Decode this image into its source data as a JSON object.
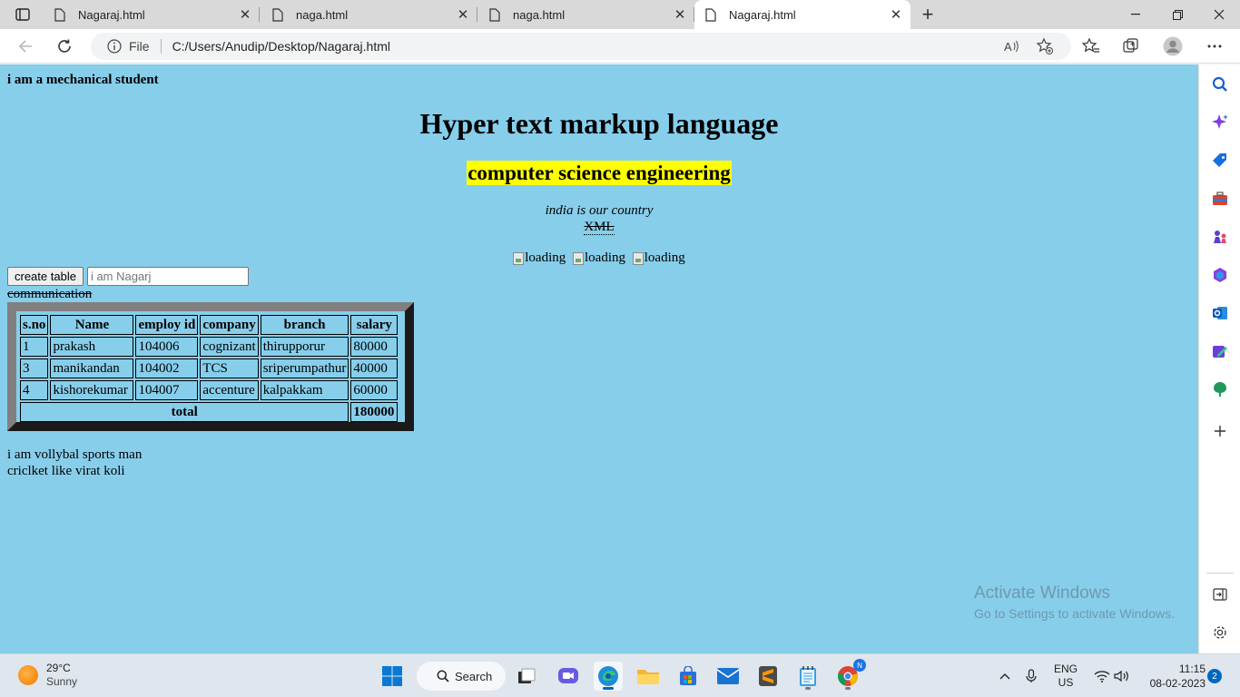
{
  "browser": {
    "tabs": [
      {
        "title": "Nagaraj.html",
        "active": false
      },
      {
        "title": "naga.html",
        "active": false
      },
      {
        "title": "naga.html",
        "active": false
      },
      {
        "title": "Nagaraj.html",
        "active": true
      }
    ],
    "address": {
      "scheme_label": "File",
      "url": "C:/Users/Anudip/Desktop/Nagaraj.html"
    }
  },
  "page": {
    "intro": "i am a mechanical student",
    "heading1": "Hyper text markup language",
    "heading2": "computer science engineering",
    "country": "india is our country",
    "xml": "XML",
    "images": [
      "loading",
      "loading",
      "loading"
    ],
    "button_label": "create table",
    "input_placeholder": "i am Nagarj",
    "strike_text": "communication",
    "table": {
      "headers": [
        "s.no",
        "Name",
        "employ id",
        "company",
        "branch",
        "salary"
      ],
      "rows": [
        [
          "1",
          "prakash",
          "104006",
          "cognizant",
          "thirupporur",
          "80000"
        ],
        [
          "3",
          "manikandan",
          "104002",
          "TCS",
          "sriperumpathur",
          "40000"
        ],
        [
          "4",
          "kishorekumar",
          "104007",
          "accenture",
          "kalpakkam",
          "60000"
        ]
      ],
      "total_label": "total",
      "total_value": "180000"
    },
    "line1": "i am vollybal sports man",
    "line2": "criclket like virat koli",
    "watermark_title": "Activate Windows",
    "watermark_sub": "Go to Settings to activate Windows."
  },
  "taskbar": {
    "weather_temp": "29°C",
    "weather_cond": "Sunny",
    "search_label": "Search",
    "lang_top": "ENG",
    "lang_bottom": "US",
    "time": "11:15",
    "date": "08-02-2023",
    "notification_count": "2",
    "chrome_badge": "N"
  }
}
